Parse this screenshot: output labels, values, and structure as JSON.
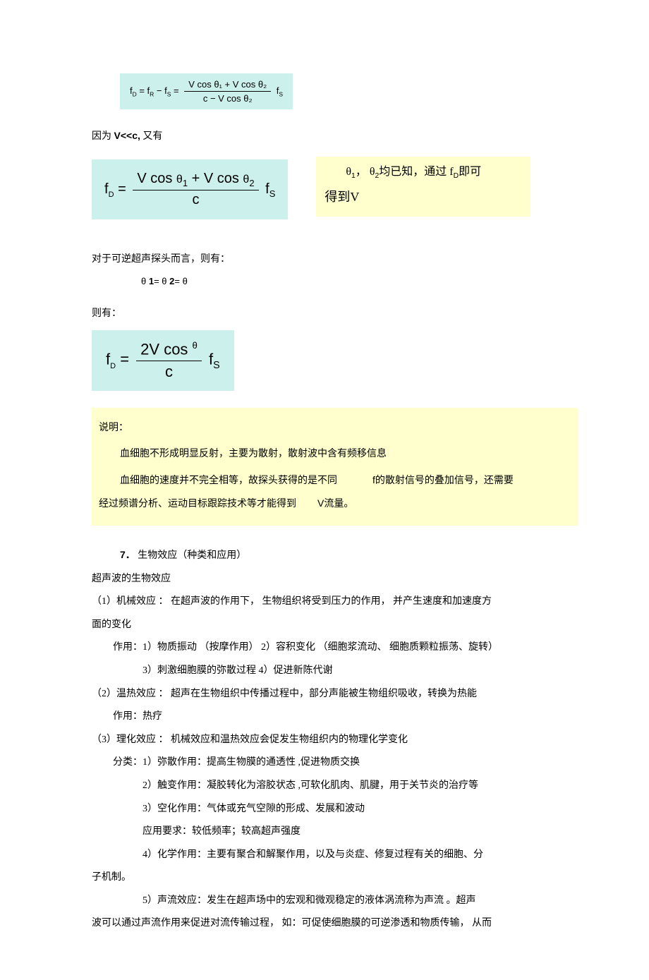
{
  "formula1": {
    "lhs_f": "f",
    "lhs_sub": "D",
    "eq1": " = f",
    "r": "R",
    "minus": " − f",
    "s": "S",
    "eq2": " = ",
    "num": "V cos θ₁ + V cos θ₂",
    "den": "c −  V cos θ₂",
    "tail_f": " f",
    "tail_s": "S"
  },
  "because": "因为 ",
  "vc": "V<<c,",
  "also": " 又有",
  "formula2": {
    "f": "f",
    "d": "D",
    "eq": " = ",
    "num_a": "V  cos ",
    "t1a": "θ",
    "t1b": "1",
    "num_plus": " + V  cos ",
    "t2a": "θ",
    "t2b": "2",
    "den": "c",
    "tail_f": " f",
    "tail_s": "S"
  },
  "yellow1_line1a": "θ",
  "yellow1_line1b": "1",
  "yellow1_line1c": "， θ",
  "yellow1_line1d": "2",
  "yellow1_line1e": "均已知，通过 f",
  "yellow1_line1f": "D",
  "yellow1_line1g": "即可",
  "yellow1_line2": "得到V",
  "probe_line": "对于可逆超声探头而言，则有：",
  "theta_eq_a": "θ",
  "theta_eq_b": "1",
  "theta_eq_c": "= θ",
  "theta_eq_d": "2",
  "theta_eq_e": "= θ",
  "then_have": "则有：",
  "formula3": {
    "f": "f",
    "d": "D",
    "eq": " = ",
    "num_a": "2V  cos ",
    "theta": "θ",
    "den": "c",
    "tail_f": " f",
    "tail_s": "S"
  },
  "explain_title": "说明：",
  "explain_p1": "血细胞不形成明显反射，主要为散射，散射波中含有频移信息",
  "explain_p2a": "血细胞的速度并不完全相等，故探头获得的是不同",
  "explain_p2b": "f",
  "explain_p2c": "的散射信号的叠加信号，还需要",
  "explain_p3a": "经过频谱分析、运动目标跟踪技术等才能得到",
  "explain_p3b": "V",
  "explain_p3c": "流量。",
  "sec7_num": "7．",
  "sec7_title": "生物效应（种类和应用）",
  "bio_title": "超声波的生物效应",
  "bio1a": "（1）机械效应 ：  在超声波的作用下，   生物组织将受到压力的作用，    并产生速度和加速度方",
  "bio1b": "面的变化",
  "bio1_use1": "作用：1）物质振动 （按摩作用）       2）容积变化 （细胞浆流动、 细胞质颗粒振荡、旋转）",
  "bio1_use2": "3）刺激细胞膜的弥散过程        4）促进新陈代谢",
  "bio2": "（2）温热效应 ：  超声在生物组织中传播过程中，部分声能被生物组织吸收，转换为热能",
  "bio2_use": "作用：热疗",
  "bio3": "（3）理化效应 ：  机械效应和温热效应会促发生物组织内的物理化学变化",
  "bio3_cat": "分类：1）弥散作用：提高生物膜的通透性      ,促进物质交换",
  "bio3_2": "2）触变作用：凝胶转化为溶胶状态      ,可软化肌肉、肌腱，用于关节炎的治疗等",
  "bio3_3": "3）空化作用：气体或充气空隙的形成、发展和波动",
  "bio3_3b": "应用要求：较低频率；较高超声强度",
  "bio3_4a": "4）化学作用：主要有聚合和解聚作用，以及与炎症、修复过程有关的细胞、分",
  "bio3_4b": "子机制。",
  "bio3_5a": "5）声流效应：发生在超声场中的宏观和微观稳定的液体涡流称为声流           。超声",
  "bio3_5b": "波可以通过声流作用来促进对流传输过程，      如：可促使细胞膜的可逆渗透和物质传输，      从而"
}
